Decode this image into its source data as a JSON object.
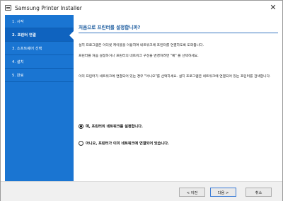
{
  "window": {
    "title": "Samsung Printer Installer",
    "close_glyph": "✕",
    "icon": "printer-icon"
  },
  "sidebar": {
    "items": [
      {
        "label": "1. 시작",
        "active": false
      },
      {
        "label": "2. 프린터 연결",
        "active": true
      },
      {
        "label": "3. 소프트웨어 선택",
        "active": false
      },
      {
        "label": "4. 설치",
        "active": false
      },
      {
        "label": "5. 완료",
        "active": false
      }
    ]
  },
  "main": {
    "heading": "처음으로 프린터를 설정합니까?",
    "paragraphs": [
      "설치 프로그램은 이더넷 케이블을 이용하여 네트워크에 프린터를 연결하도록 도와줍니다.",
      "프린터를 처음 설정하거나 프린터의 네트워크 구성을 변경하려면 \"예\" 를 선택하세요.",
      "이미 프린터가 네트워크에 연결되어 있는 경우 \"아니오\"를 선택하세요. 설치 프로그램은 네트워크에 연결되어 있는 프린터를 검색합니다."
    ],
    "options": [
      {
        "label": "예, 프린터의 네트워크를 설정합니다.",
        "checked": true
      },
      {
        "label": "아니오, 프린터가 이미 네트워크에 연결되어 있습니다.",
        "checked": false
      }
    ]
  },
  "footer": {
    "back_label": "< 이전",
    "next_label": "다음 >",
    "cancel_label": "취소"
  },
  "colors": {
    "sidebar_bg": "#1a75d2",
    "sidebar_active": "#0f63bf",
    "heading": "#1a5a9e",
    "accent_rule": "#3a78c0"
  }
}
